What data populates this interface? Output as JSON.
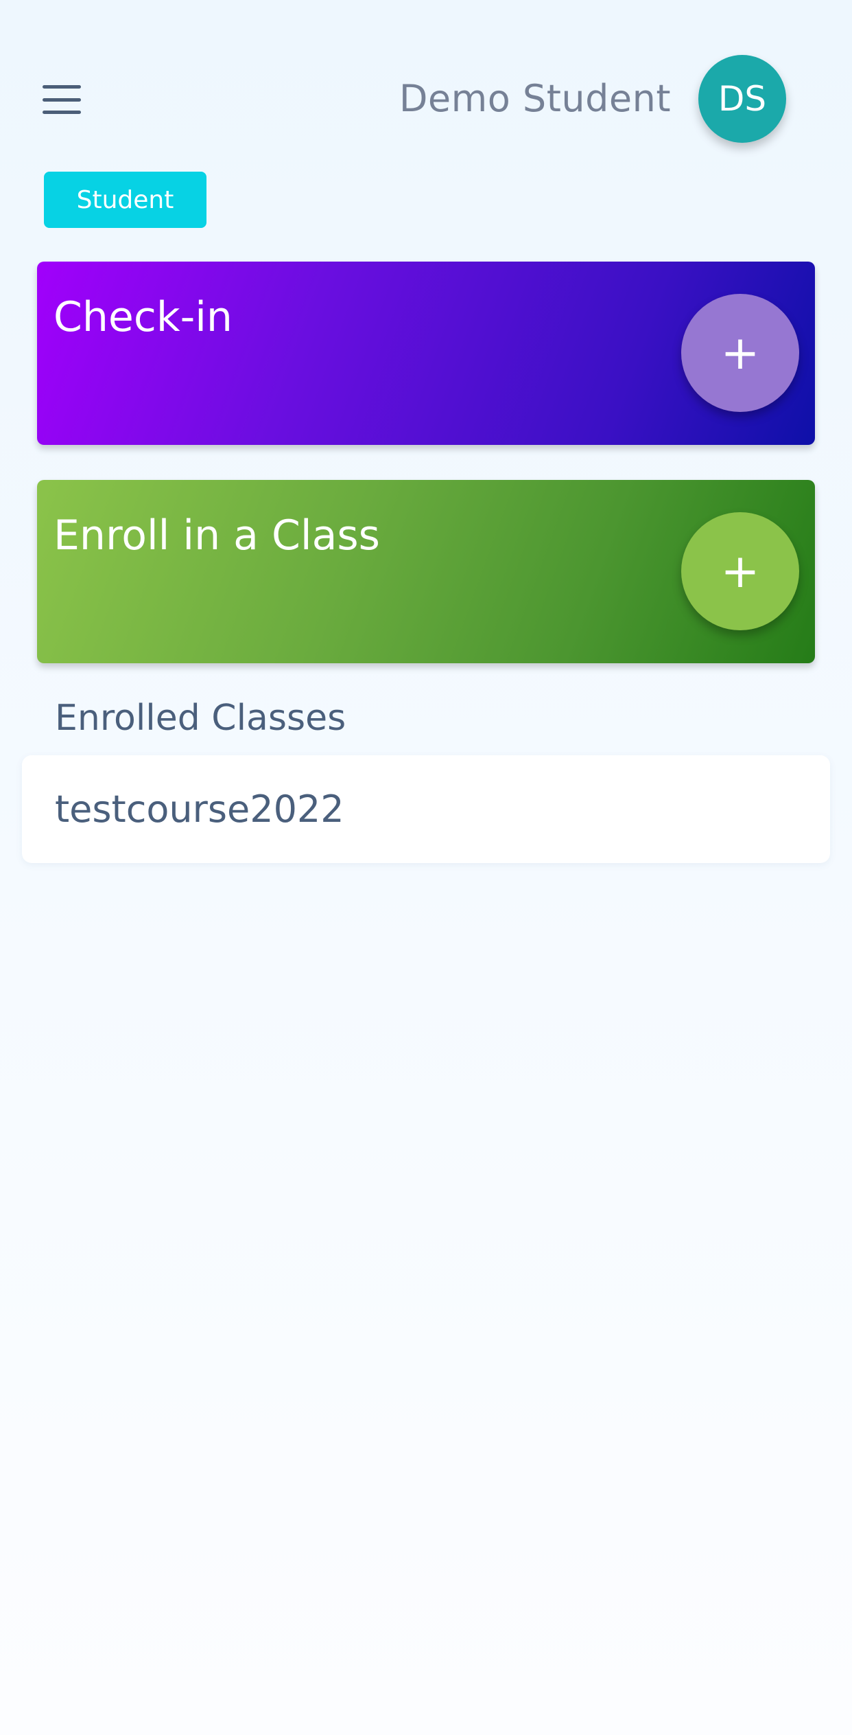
{
  "header": {
    "menu_icon": "hamburger-menu-icon",
    "user_name": "Demo Student",
    "avatar_initials": "DS",
    "avatar_color": "#1ba9aa"
  },
  "role_badge": {
    "label": "Student",
    "color": "#07d2e4"
  },
  "cards": [
    {
      "title": "Check-in",
      "action_icon": "plus-icon",
      "action_label": "+",
      "colors": [
        "#a100fb",
        "#0e10a8"
      ],
      "fab_color": "#9677d2"
    },
    {
      "title": "Enroll in a Class",
      "action_icon": "plus-icon",
      "action_label": "+",
      "colors": [
        "#8bc34a",
        "#257c18"
      ],
      "fab_color": "#8bc34a"
    }
  ],
  "enrolled": {
    "section_title": "Enrolled Classes",
    "classes": [
      {
        "name": "testcourse2022"
      }
    ]
  }
}
